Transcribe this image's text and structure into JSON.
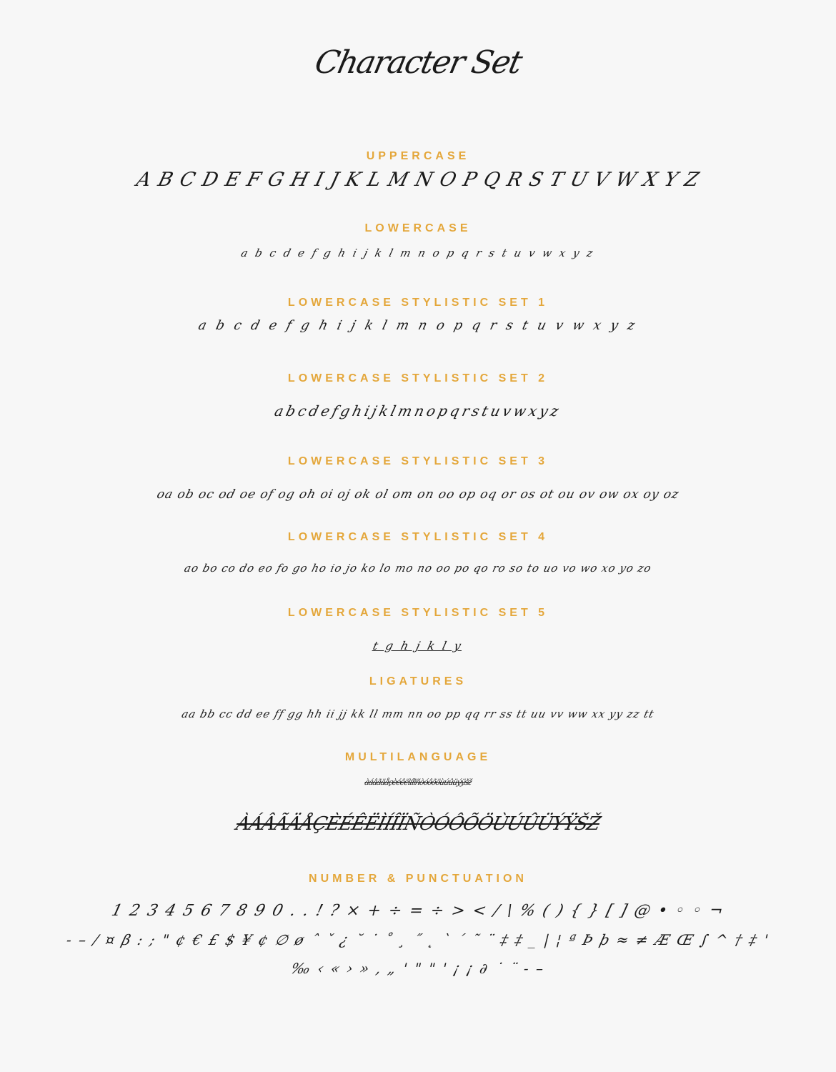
{
  "title": "Character Set",
  "sections": {
    "uppercase": {
      "heading": "UPPERCASE",
      "glyphs": "A B C D E F G H I J K L M N O P Q R S T U V W X Y Z"
    },
    "lowercase": {
      "heading": "LOWERCASE",
      "glyphs": "a b c d e f g h i j k l m n o p q r s t u v w x y z"
    },
    "ss1": {
      "heading": "LOWERCASE STYLISTIC SET 1",
      "glyphs": "a b c d e f g h i j k l m n o p q r s t u v w x y z"
    },
    "ss2": {
      "heading": "LOWERCASE STYLISTIC SET 2",
      "glyphs": "abcdefghijklmnopqrstuvwxyz"
    },
    "ss3": {
      "heading": "LOWERCASE STYLISTIC SET 3",
      "glyphs": "oa ob oc od oe of og oh oi oj ok ol om on oo op oq or os ot ou ov ow ox oy oz"
    },
    "ss4": {
      "heading": "LOWERCASE STYLISTIC SET 4",
      "glyphs": "ao bo co do eo fo go ho io jo ko lo mo no oo po qo ro so to uo vo wo xo yo zo"
    },
    "ss5": {
      "heading": "LOWERCASE STYLISTIC SET 5",
      "glyphs": "t g h j k l y"
    },
    "ligatures": {
      "heading": "LIGATURES",
      "glyphs": "aa bb cc dd ee ff gg hh ii jj kk ll mm nn oo pp qq rr ss tt uu vv ww xx yy zz tt"
    },
    "multilanguage": {
      "heading": "MULTILANGUAGE",
      "glyphs_lower": "àáâãäåçèéêëìíîïñòóôõöùúûüýÿšž",
      "glyphs_upper": "ÀÁÂÃÄÅÇÈÉÊËÌÍÎÏÑÒÓÔÕÖÙÚÛÜÝŸŠŽ"
    },
    "numbers": {
      "heading": "NUMBER & PUNCTUATION",
      "line1": "1 2 3 4 5 6 7 8 9 0 . . ! ? × + ÷ = ÷ > < / \\ % ( ) { }    [ ] @ • ◦ ◦ ¬",
      "line2": "- – / ¤ β : ; \" ¢ € £ $ ¥ ¢ ∅ ø ˆ ˇ ¿ ˘ ˙ ˚ ¸ ˝ ˛ ` ´ ˜ ¨ ‡ ‡ _ | ¦ ª Þ þ ≈ ≠ Æ Œ ∫ ^ † ‡ '",
      "line3": "‰ ‹ « › » ‚ „ ' \" \" ' ¡ ¡ ∂ ˙ ¨ - –"
    }
  }
}
